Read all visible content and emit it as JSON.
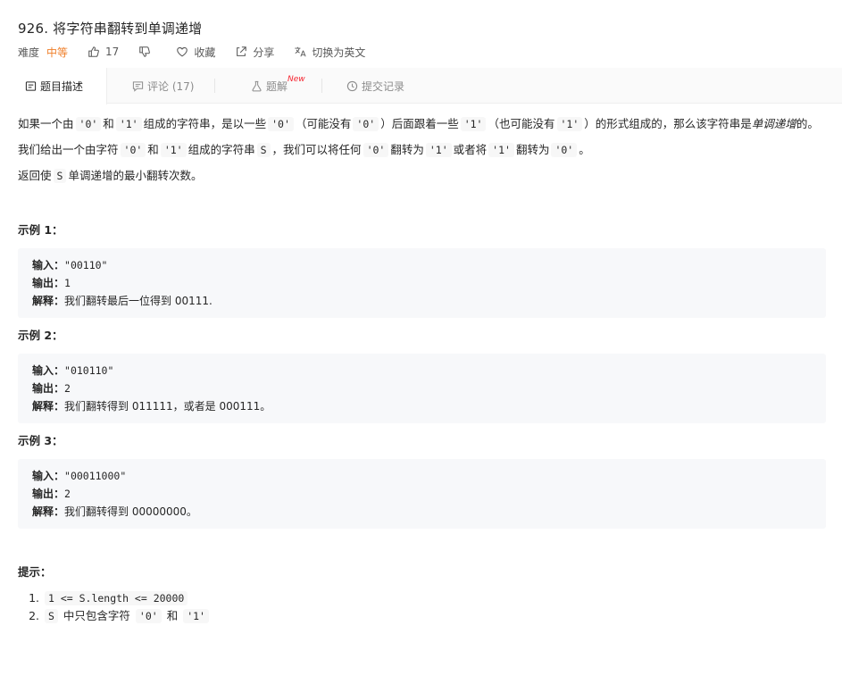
{
  "problem": {
    "title": "926. 将字符串翻转到单调递增",
    "difficulty_label": "难度",
    "difficulty": "中等",
    "likes": "17",
    "favorite": "收藏",
    "share": "分享",
    "switch_lang": "切换为英文"
  },
  "tabs": {
    "description": "题目描述",
    "comments": "评论 (17)",
    "solutions": "题解",
    "new_badge": "New",
    "submissions": "提交记录"
  },
  "desc": {
    "p1_a": "如果一个由",
    "c0": "'0'",
    "and": "和",
    "c1": "'1'",
    "p1_b": "组成的字符串，是以一些",
    "p1_c": "（可能没有",
    "p1_d": "）后面跟着一些",
    "p1_e": "（也可能没有",
    "p1_f": "）的形式组成的，那么该字符串是",
    "p1_em": "单调递增",
    "p1_g": "的。",
    "p2_a": "我们给出一个由字符",
    "p2_b": "组成的字符串",
    "S": "S",
    "p2_c": "，我们可以将任何",
    "p2_d": "翻转为",
    "p2_e": "或者将",
    "p2_f": "翻转为",
    "p2_g": "。",
    "p3_a": "返回使",
    "p3_b": "单调递增的最小翻转次数。"
  },
  "labels": {
    "input": "输入：",
    "output": "输出：",
    "explain": "解释："
  },
  "examples": [
    {
      "title": "示例 1：",
      "input": "\"00110\"",
      "output": "1",
      "explanation": "我们翻转最后一位得到 00111."
    },
    {
      "title": "示例 2：",
      "input": "\"010110\"",
      "output": "2",
      "explanation": "我们翻转得到 011111，或者是 000111。"
    },
    {
      "title": "示例 3：",
      "input": "\"00011000\"",
      "output": "2",
      "explanation": "我们翻转得到 00000000。"
    }
  ],
  "hints": {
    "title": "提示：",
    "h1_code": "1 <= S.length <= 20000",
    "h2_text": "中只包含字符",
    "h2_and": "和"
  },
  "icons": [
    "thumb-up-icon",
    "thumb-down-icon",
    "heart-icon",
    "share-icon",
    "translate-icon",
    "description-icon",
    "comment-icon",
    "flask-icon",
    "clock-icon"
  ],
  "colors": {
    "difficulty": "#ef7f2a",
    "new_badge": "#f5222d"
  }
}
